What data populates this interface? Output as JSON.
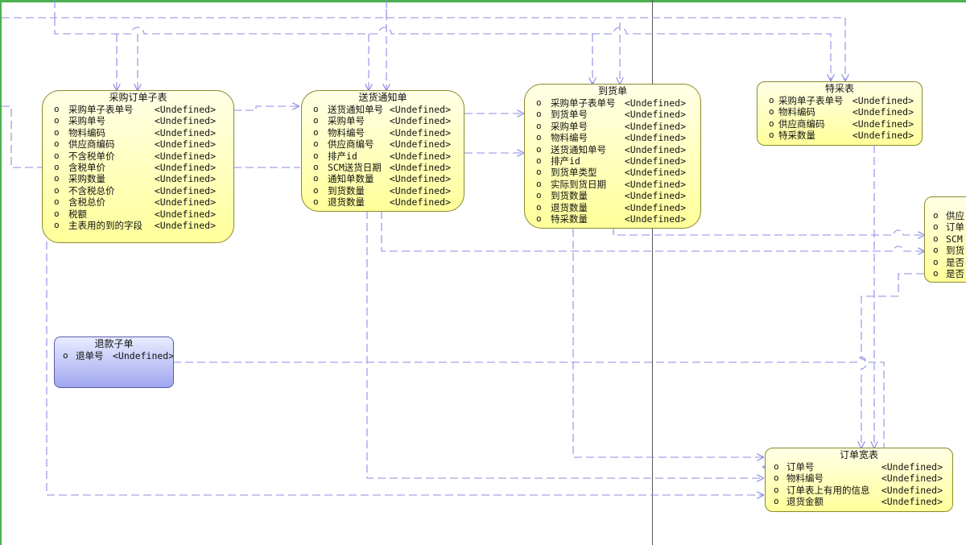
{
  "diagram": {
    "entities": [
      {
        "key": "purchase_order_sub",
        "title": "采购订单子表",
        "attributes": [
          {
            "name": "采购单子表单号",
            "type": "<Undefined>"
          },
          {
            "name": "采购单号",
            "type": "<Undefined>"
          },
          {
            "name": "物料编码",
            "type": "<Undefined>"
          },
          {
            "name": "供应商编码",
            "type": "<Undefined>"
          },
          {
            "name": "不含税单价",
            "type": "<Undefined>"
          },
          {
            "name": "含税单价",
            "type": "<Undefined>"
          },
          {
            "name": "采购数量",
            "type": "<Undefined>"
          },
          {
            "name": "不含税总价",
            "type": "<Undefined>"
          },
          {
            "name": "含税总价",
            "type": "<Undefined>"
          },
          {
            "name": "税额",
            "type": "<Undefined>"
          },
          {
            "name": "主表用的到的字段",
            "type": "<Undefined>"
          }
        ]
      },
      {
        "key": "delivery_notice",
        "title": "送货通知单",
        "attributes": [
          {
            "name": "送货通知单号",
            "type": "<Undefined>"
          },
          {
            "name": "采购单号",
            "type": "<Undefined>"
          },
          {
            "name": "物料编号",
            "type": "<Undefined>"
          },
          {
            "name": "供应商编号",
            "type": "<Undefined>"
          },
          {
            "name": "排产id",
            "type": "<Undefined>"
          },
          {
            "name": "SCM送货日期",
            "type": "<Undefined>"
          },
          {
            "name": "通知单数量",
            "type": "<Undefined>"
          },
          {
            "name": "到货数量",
            "type": "<Undefined>"
          },
          {
            "name": "退货数量",
            "type": "<Undefined>"
          }
        ]
      },
      {
        "key": "arrival_order",
        "title": "到货单",
        "attributes": [
          {
            "name": "采购单子表单号",
            "type": "<Undefined>"
          },
          {
            "name": "到货单号",
            "type": "<Undefined>"
          },
          {
            "name": "采购单号",
            "type": "<Undefined>"
          },
          {
            "name": "物料编号",
            "type": "<Undefined>"
          },
          {
            "name": "送货通知单号",
            "type": "<Undefined>"
          },
          {
            "name": "排产id",
            "type": "<Undefined>"
          },
          {
            "name": "到货单类型",
            "type": "<Undefined>"
          },
          {
            "name": "实际到货日期",
            "type": "<Undefined>"
          },
          {
            "name": "到货数量",
            "type": "<Undefined>"
          },
          {
            "name": "退货数量",
            "type": "<Undefined>"
          },
          {
            "name": "特采数量",
            "type": "<Undefined>"
          }
        ]
      },
      {
        "key": "special_purchase",
        "title": "特采表",
        "attributes": [
          {
            "name": "采购单子表单号",
            "type": "<Undefined>"
          },
          {
            "name": "物料编码",
            "type": "<Undefined>"
          },
          {
            "name": "供应商编码",
            "type": "<Undefined>"
          },
          {
            "name": "特采数量",
            "type": "<Undefined>"
          }
        ]
      },
      {
        "key": "partial_entity",
        "title": "",
        "attributes": [
          {
            "name": "供应",
            "type": ""
          },
          {
            "name": "订单",
            "type": ""
          },
          {
            "name": "SCM",
            "type": ""
          },
          {
            "name": "到货",
            "type": ""
          },
          {
            "name": "是否",
            "type": ""
          },
          {
            "name": "是否",
            "type": ""
          }
        ]
      },
      {
        "key": "refund_sub",
        "title": "退款子单",
        "attributes": [
          {
            "name": "退单号",
            "type": "<Undefined>"
          }
        ]
      },
      {
        "key": "order_wide",
        "title": "订单宽表",
        "attributes": [
          {
            "name": "订单号",
            "type": "<Undefined>"
          },
          {
            "name": "物料编号",
            "type": "<Undefined>"
          },
          {
            "name": "订单表上有用的信息",
            "type": "<Undefined>"
          },
          {
            "name": "退货金额",
            "type": "<Undefined>"
          }
        ]
      }
    ],
    "bullet": "o",
    "colors": {
      "connector": "#8c8ce6",
      "entity_fill": "#ffff9a",
      "entity_border": "#8a8a2a",
      "blue_fill": "#9fa6ee",
      "page_border": "#4caf50"
    }
  }
}
